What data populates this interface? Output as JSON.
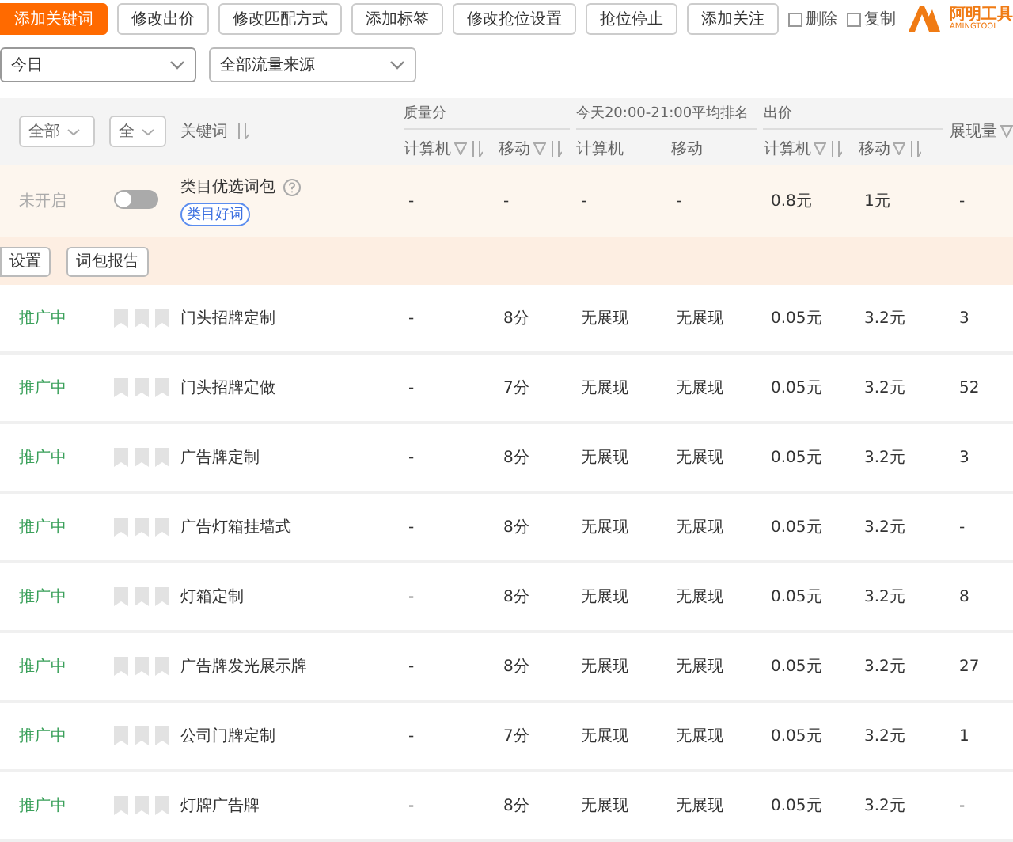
{
  "toolbar": {
    "buttons": [
      {
        "label": "添加关键词",
        "kind": "primary"
      },
      {
        "label": "修改出价",
        "kind": "default"
      },
      {
        "label": "修改匹配方式",
        "kind": "default"
      },
      {
        "label": "添加标签",
        "kind": "default"
      },
      {
        "label": "修改抢位设置",
        "kind": "default"
      },
      {
        "label": "抢位停止",
        "kind": "default"
      },
      {
        "label": "添加关注",
        "kind": "default"
      }
    ],
    "checkboxes": [
      {
        "label": "删除",
        "checked": false
      },
      {
        "label": "复制",
        "checked": false
      }
    ],
    "logo": {
      "name": "阿明工具",
      "subtitle": "AMINGTOOL"
    }
  },
  "filters": [
    {
      "value": "今日"
    },
    {
      "value": "全部流量来源"
    }
  ],
  "table": {
    "header": {
      "selects": [
        "全部",
        "全"
      ],
      "keyword": "关键词",
      "groups": [
        {
          "label": "质量分",
          "columns": [
            {
              "label": "计算机",
              "kind": "sortable"
            },
            {
              "label": "移动",
              "kind": "sortable"
            }
          ]
        },
        {
          "label": "今天20:00-21:00平均排名",
          "columns": [
            {
              "label": "计算机",
              "kind": "plain"
            },
            {
              "label": "移动",
              "kind": "plain"
            }
          ]
        },
        {
          "label": "出价",
          "columns": [
            {
              "label": "计算机",
              "kind": "sortable"
            },
            {
              "label": "移动",
              "kind": "sortable"
            }
          ]
        }
      ],
      "last": "展现量"
    },
    "package": {
      "status": "未开启",
      "on": false,
      "name": "类目优选词包",
      "tag": "类目好词",
      "cells": [
        "-",
        "-",
        "-",
        "-",
        "0.8元",
        "1元",
        "-"
      ],
      "actions": [
        "设置",
        "词包报告"
      ]
    },
    "rows": [
      {
        "status": "推广中",
        "keyword": "门头招牌定制",
        "cells": [
          "-",
          "8分",
          "无展现",
          "无展现",
          "0.05元",
          "3.2元",
          "3"
        ]
      },
      {
        "status": "推广中",
        "keyword": "门头招牌定做",
        "cells": [
          "-",
          "7分",
          "无展现",
          "无展现",
          "0.05元",
          "3.2元",
          "52"
        ]
      },
      {
        "status": "推广中",
        "keyword": "广告牌定制",
        "cells": [
          "-",
          "8分",
          "无展现",
          "无展现",
          "0.05元",
          "3.2元",
          "3"
        ]
      },
      {
        "status": "推广中",
        "keyword": "广告灯箱挂墙式",
        "cells": [
          "-",
          "8分",
          "无展现",
          "无展现",
          "0.05元",
          "3.2元",
          "-"
        ]
      },
      {
        "status": "推广中",
        "keyword": "灯箱定制",
        "cells": [
          "-",
          "8分",
          "无展现",
          "无展现",
          "0.05元",
          "3.2元",
          "8"
        ]
      },
      {
        "status": "推广中",
        "keyword": "广告牌发光展示牌",
        "cells": [
          "-",
          "8分",
          "无展现",
          "无展现",
          "0.05元",
          "3.2元",
          "27"
        ]
      },
      {
        "status": "推广中",
        "keyword": "公司门牌定制",
        "cells": [
          "-",
          "7分",
          "无展现",
          "无展现",
          "0.05元",
          "3.2元",
          "1"
        ]
      },
      {
        "status": "推广中",
        "keyword": "灯牌广告牌",
        "cells": [
          "-",
          "8分",
          "无展现",
          "无展现",
          "0.05元",
          "3.2元",
          "-"
        ]
      }
    ]
  }
}
